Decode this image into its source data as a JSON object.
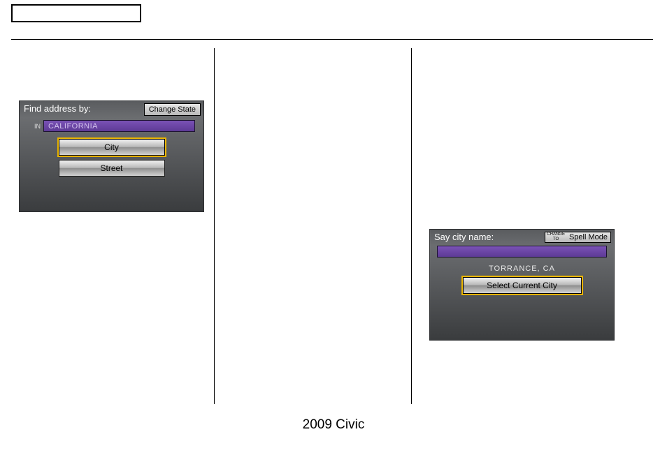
{
  "footer": "2009  Civic",
  "screen1": {
    "title": "Find address by:",
    "change_state_btn": "Change State",
    "in_label": "IN",
    "state_field": "CALIFORNIA",
    "city_btn": "City",
    "street_btn": "Street"
  },
  "screen2": {
    "title": "Say city name:",
    "change_to_prefix": "CHANGE\nTO",
    "spell_mode_btn": "Spell Mode",
    "input_value": "",
    "current_city": "TORRANCE, CA",
    "select_current_btn": "Select Current City"
  }
}
